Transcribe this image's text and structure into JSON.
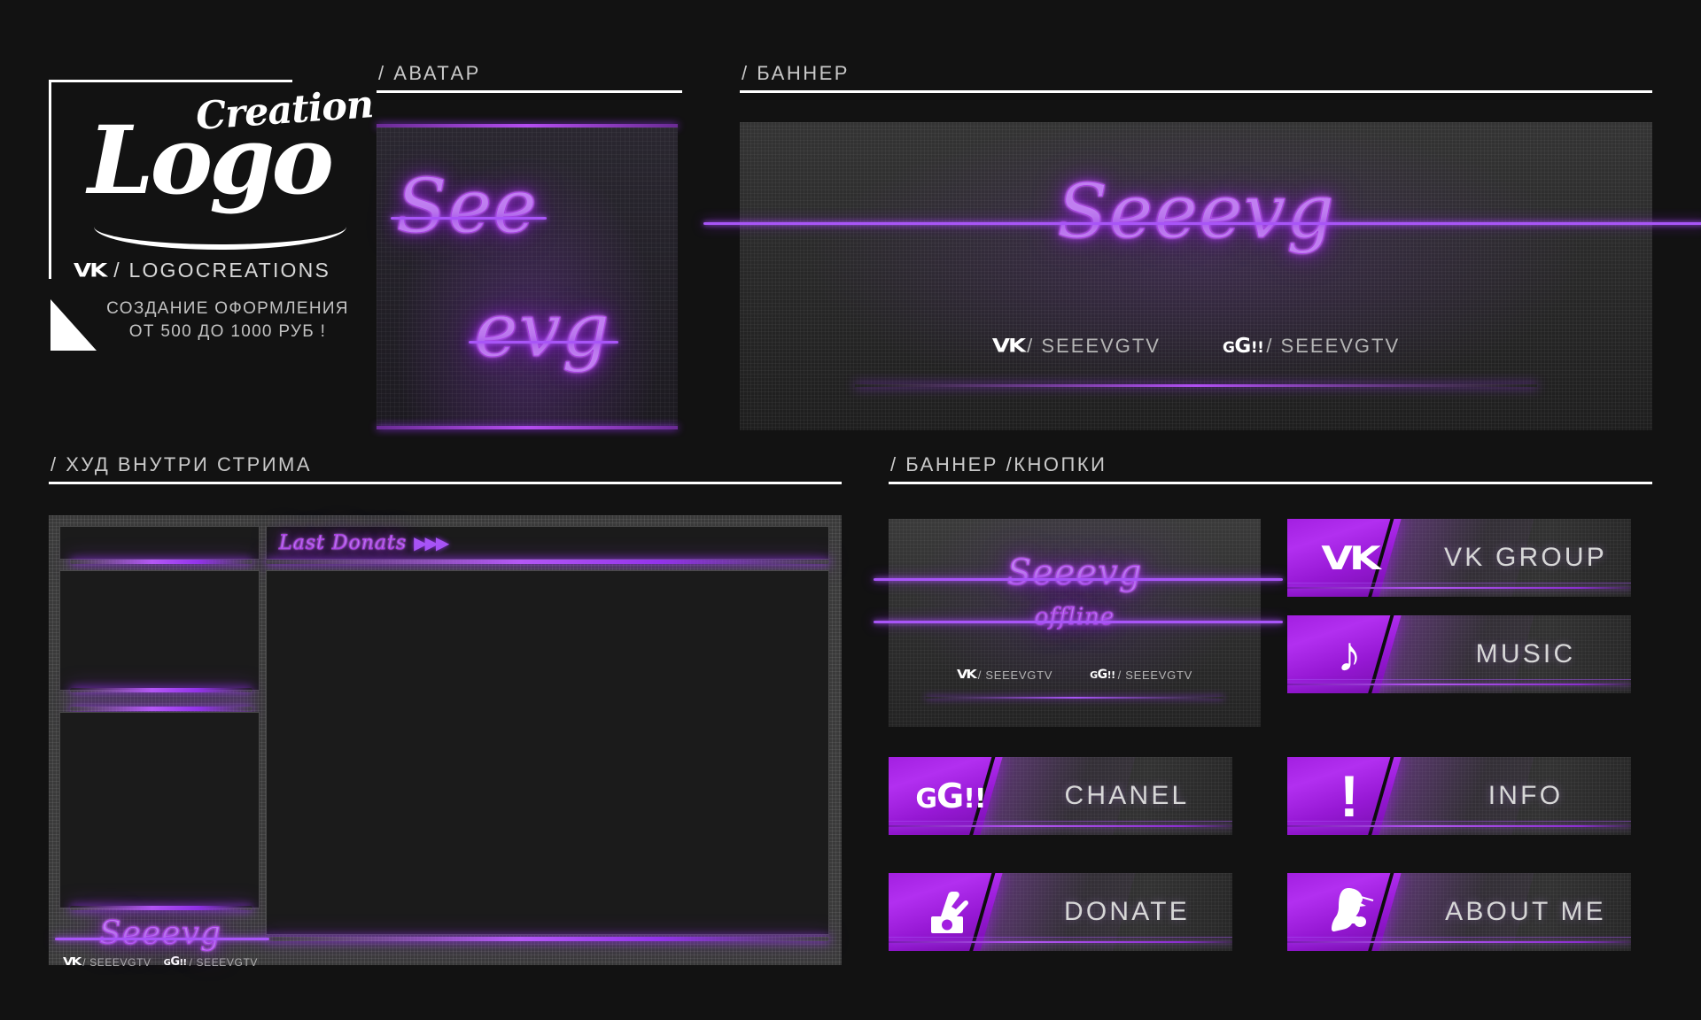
{
  "brand": {
    "script_top": "Creation",
    "script_main": "Logo",
    "vk_icon": "vk-icon",
    "vk_handle": "/ LOGOCREATIONS",
    "price_line1": "СОЗДАНИЕ ОФОРМЛЕНИЯ",
    "price_line2": "ОТ 500 ДО 1000 РУБ !"
  },
  "sections": {
    "avatar": "/ АВАТАР",
    "banner": "/ БАННЕР",
    "hud": "/ ХУД ВНУТРИ СТРИМА",
    "buttons": "/ БАННЕР /КНОПКИ"
  },
  "avatar": {
    "line1": "See",
    "line2": "evg"
  },
  "banner": {
    "name": "Seeevg",
    "vk_icon": "vk-icon",
    "vk_handle": "/ SEEEVGTV",
    "gg_icon": "gg-icon",
    "gg_main": "G",
    "gg_small_left": "G",
    "gg_bangs": "!!",
    "gg_handle": "/ SEEEVGTV"
  },
  "hud": {
    "donats_title": "Last Donats",
    "donats_arrows": "▶▶▶",
    "signature_name": "Seeevg",
    "vk_handle": "/ SEEEVGTV",
    "gg_handle": "/ SEEEVGTV"
  },
  "offline": {
    "name": "Seeevg",
    "status": "offline",
    "vk_handle": "/ SEEEVGTV",
    "gg_handle": "/ SEEEVGTV"
  },
  "buttons": [
    {
      "label": "VK GROUP",
      "icon": "vk-icon",
      "glyph": "VK"
    },
    {
      "label": "MUSIC",
      "icon": "music-note-icon",
      "glyph": "♪"
    },
    {
      "label": "CHANEL",
      "icon": "gg-icon",
      "glyph": "GG!!"
    },
    {
      "label": "INFO",
      "icon": "exclamation-icon",
      "glyph": "!"
    },
    {
      "label": "DONATE",
      "icon": "hand-money-icon",
      "glyph": "☝"
    },
    {
      "label": "ABOUT ME",
      "icon": "detective-icon",
      "glyph": "🕵"
    }
  ],
  "colors": {
    "accent_purple": "#a21fe0",
    "accent_light": "#b458f5",
    "neon": "#c07ff0",
    "background": "#121212",
    "panel": "#2b2b2b",
    "text_light": "#d7d7d7"
  }
}
